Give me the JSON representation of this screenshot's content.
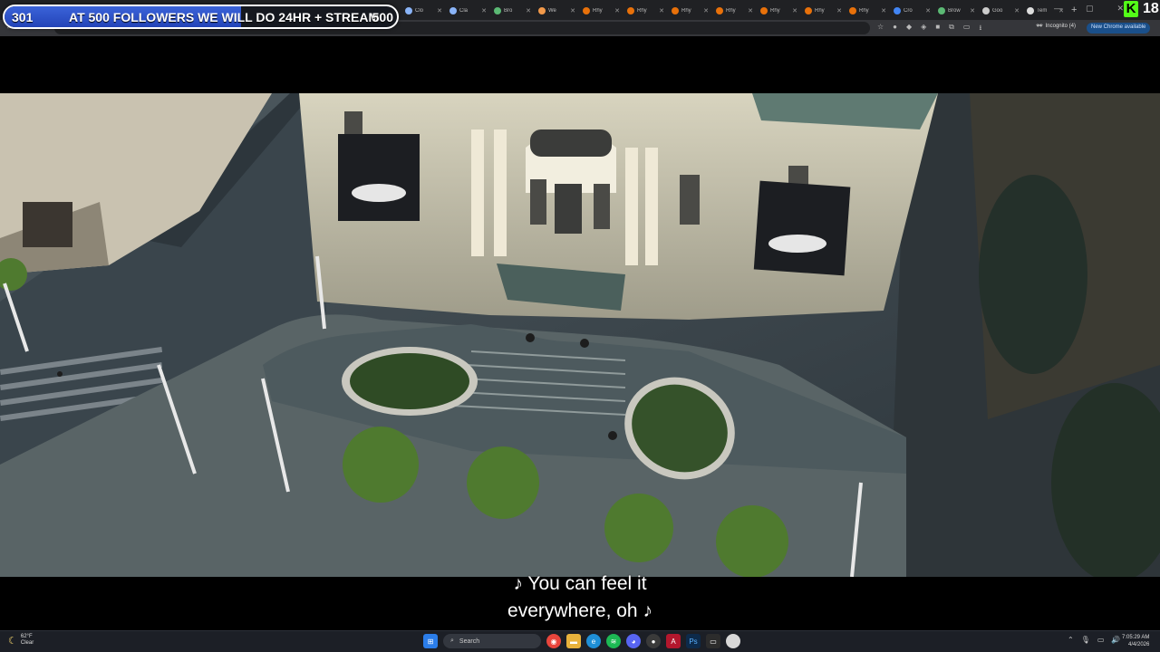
{
  "overlay": {
    "goal_current": "301",
    "goal_message": "AT 500 FOLLOWERS WE WILL DO 24HR + STREAM",
    "goal_target": "500",
    "goal_progress": 0.602,
    "kick_count": "18"
  },
  "browser": {
    "tabs": [
      {
        "label": "Clo",
        "icon": "globe-icon",
        "color": "#8ab4f8"
      },
      {
        "label": "Cla",
        "icon": "globe-icon",
        "color": "#8ab4f8"
      },
      {
        "label": "Bro",
        "icon": "globe-icon",
        "color": "#5bb974"
      },
      {
        "label": "We",
        "icon": "windows-icon",
        "color": "#f2994a"
      },
      {
        "label": "Rhy",
        "icon": "youtube-icon",
        "color": "#e8710a"
      },
      {
        "label": "Rhy",
        "icon": "youtube-icon",
        "color": "#e8710a"
      },
      {
        "label": "Rhy",
        "icon": "youtube-icon",
        "color": "#e8710a"
      },
      {
        "label": "Rhy",
        "icon": "youtube-icon",
        "color": "#e8710a"
      },
      {
        "label": "Rhy",
        "icon": "youtube-icon",
        "color": "#e8710a"
      },
      {
        "label": "Rhy",
        "icon": "youtube-icon",
        "color": "#e8710a"
      },
      {
        "label": "Rhy",
        "icon": "youtube-icon",
        "color": "#e8710a"
      },
      {
        "label": "Cro",
        "icon": "globe-icon",
        "color": "#4285f4"
      },
      {
        "label": "Brow",
        "icon": "globe-icon",
        "color": "#5bb974"
      },
      {
        "label": "Goo",
        "icon": "google-icon",
        "color": "#cccccc"
      },
      {
        "label": "Tem",
        "icon": "globe-icon",
        "color": "#dddddd"
      }
    ],
    "incognito_label": "Incognito (4)",
    "new_chrome_label": "New Chrome available"
  },
  "captions": {
    "line1": "♪  You can feel it",
    "line2": "everywhere, oh  ♪"
  },
  "taskbar": {
    "weather_temp": "62°F",
    "weather_cond": "Clear",
    "search_label": "Search",
    "time": "7:05:29 AM",
    "date": "4/4/2026"
  }
}
